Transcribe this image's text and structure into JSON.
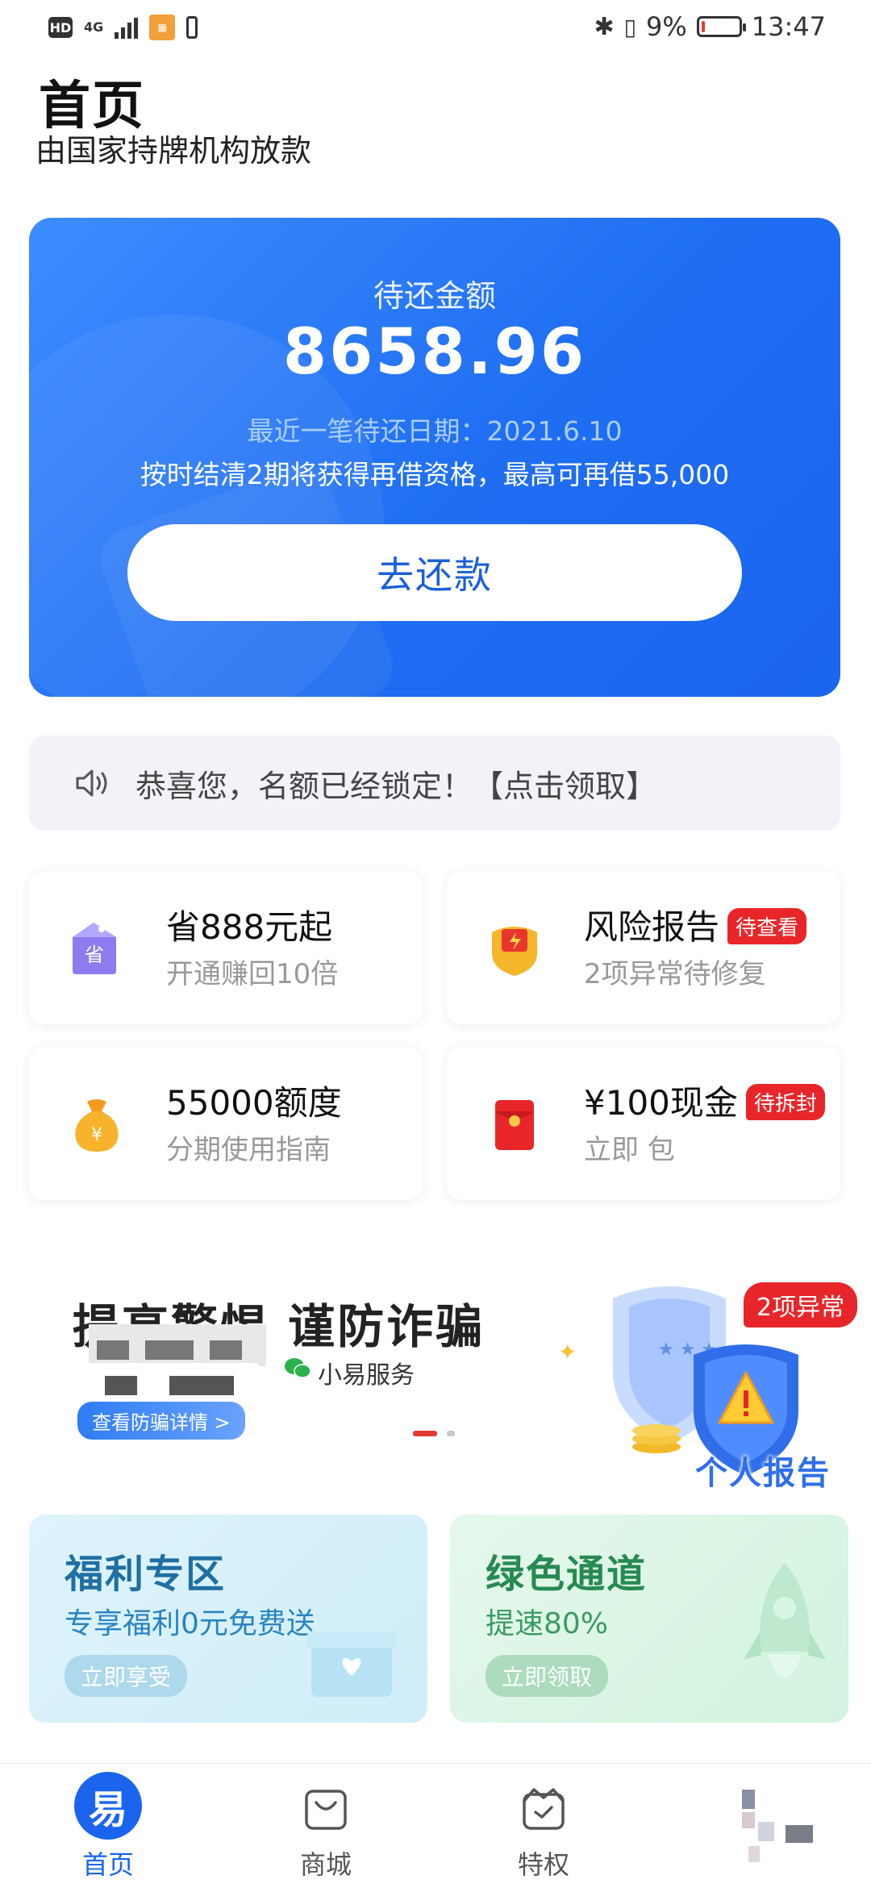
{
  "status_bar": {
    "hd": "HD",
    "network": "4G",
    "battery_percent": "9%",
    "battery_level": 0.09,
    "time": "13:47"
  },
  "header": {
    "title": "首页",
    "subtitle": "由国家持牌机构放款"
  },
  "loan_card": {
    "label": "待还金额",
    "amount": "8658.96",
    "due_date_text": "最近一笔待还日期：2021.6.10",
    "note": "按时结清2期将获得再借资格，最高可再借55,000",
    "button_label": "去还款"
  },
  "notice": {
    "icon": "speaker-icon",
    "text": "恭喜您，名额已经锁定！【点击领取】"
  },
  "features": [
    {
      "title": "省888元起",
      "subtitle": "开通赚回10倍",
      "badge": "",
      "icon": "tag-icon"
    },
    {
      "title": "风险报告",
      "subtitle": "2项异常待修复",
      "badge": "待查看",
      "icon": "shield-alert-icon"
    },
    {
      "title": "55000额度",
      "subtitle": "分期使用指南",
      "badge": "",
      "icon": "money-bag-icon"
    },
    {
      "title": "¥100现金",
      "subtitle": "立即 包",
      "badge": "待拆封",
      "icon": "red-envelope-icon"
    }
  ],
  "banner": {
    "title": "提高警惕 谨防诈骗",
    "service": "小易服务",
    "link": "查看防骗详情 >",
    "badge": "2项异常",
    "report": "个人报告"
  },
  "promos": [
    {
      "title": "福利专区",
      "subtitle": "专享福利0元免费送",
      "button": "立即享受"
    },
    {
      "title": "绿色通道",
      "subtitle": "提速80%",
      "button": "立即领取"
    }
  ],
  "nav": {
    "home_logo": "易",
    "items": [
      {
        "label": "首页",
        "icon": "home-icon"
      },
      {
        "label": "商城",
        "icon": "shopping-bag-icon"
      },
      {
        "label": "特权",
        "icon": "privilege-icon"
      }
    ]
  },
  "colors": {
    "primary": "#1b65ee",
    "badge_red": "#e8262a",
    "promo_blue": "#1f6fa3",
    "promo_green": "#278a52"
  }
}
